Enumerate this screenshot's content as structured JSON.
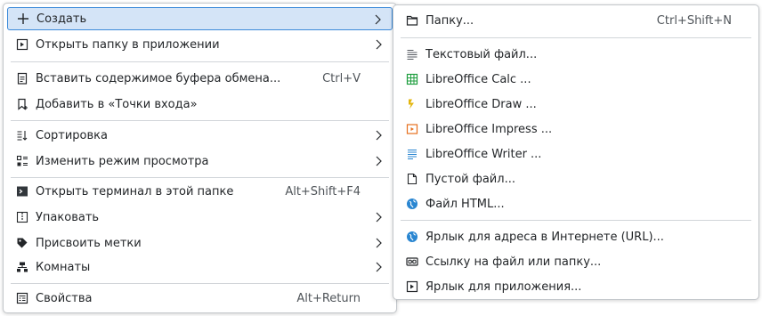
{
  "main_menu": {
    "items": [
      {
        "label": "Создать",
        "icon": "plus-icon"
      },
      {
        "label": "Открыть папку в приложении",
        "icon": "app-window-icon"
      },
      {
        "label": "Вставить содержимое буфера обмена...",
        "shortcut": "Ctrl+V",
        "icon": "clipboard-icon"
      },
      {
        "label": "Добавить в «Точки входа»",
        "icon": "bookmark-add-icon"
      },
      {
        "label": "Сортировка",
        "icon": "sort-icon"
      },
      {
        "label": "Изменить режим просмотра",
        "icon": "view-mode-icon"
      },
      {
        "label": "Открыть терминал в этой папке",
        "shortcut": "Alt+Shift+F4",
        "icon": "terminal-icon"
      },
      {
        "label": "Упаковать",
        "icon": "archive-icon"
      },
      {
        "label": "Присвоить метки",
        "icon": "tag-icon"
      },
      {
        "label": "Комнаты",
        "icon": "activities-icon"
      },
      {
        "label": "Свойства",
        "shortcut": "Alt+Return",
        "icon": "properties-icon"
      }
    ]
  },
  "sub_menu": {
    "items": [
      {
        "label": "Папку...",
        "shortcut": "Ctrl+Shift+N",
        "icon": "folder-icon"
      },
      {
        "label": "Текстовый файл...",
        "icon": "text-file-icon"
      },
      {
        "label": "LibreOffice Calc  ...",
        "icon": "calc-icon"
      },
      {
        "label": "LibreOffice Draw  ...",
        "icon": "draw-icon"
      },
      {
        "label": "LibreOffice Impress  ...",
        "icon": "impress-icon"
      },
      {
        "label": "LibreOffice Writer  ...",
        "icon": "writer-icon"
      },
      {
        "label": "Пустой файл...",
        "icon": "empty-file-icon"
      },
      {
        "label": "Файл HTML...",
        "icon": "globe-icon"
      },
      {
        "label": "Ярлык для адреса в Интернете (URL)...",
        "icon": "globe-link-icon"
      },
      {
        "label": "Ссылку на файл или папку...",
        "icon": "link-icon"
      },
      {
        "label": "Ярлык для приложения...",
        "icon": "app-shortcut-icon"
      }
    ]
  },
  "colors": {
    "highlight_bg": "#d4e4f7",
    "highlight_border": "#3b8ad9",
    "calc": "#1e9e3e",
    "draw": "#e3b50c",
    "impress": "#e7701e",
    "writer": "#2a86d1",
    "globe": "#2a86d1"
  }
}
